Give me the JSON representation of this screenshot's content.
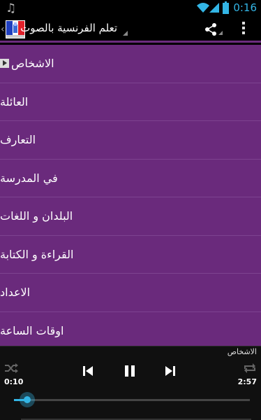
{
  "status_bar": {
    "time": "0:16",
    "icons": [
      "music-note-icon",
      "wifi-icon",
      "signal-icon",
      "battery-icon"
    ],
    "accent": "#33b5e5"
  },
  "action_bar": {
    "title": "تعلم الفرنسية بالصوت",
    "icons": [
      "app-logo-icon",
      "share-icon",
      "overflow-menu-icon"
    ],
    "divider_color": "#6b2c7e"
  },
  "list": {
    "background": "#6a2a7c",
    "items": [
      {
        "label": "الاشخاص"
      },
      {
        "label": "العائلة"
      },
      {
        "label": "التعارف"
      },
      {
        "label": "في المدرسة"
      },
      {
        "label": "البلدان و اللغات"
      },
      {
        "label": "القراءة و الكتابة"
      },
      {
        "label": "الاعداد"
      },
      {
        "label": "اوقات الساعة"
      }
    ]
  },
  "player": {
    "now_playing": "الاشخاص",
    "current_time": "0:10",
    "total_time": "2:57",
    "progress_fraction": 0.056,
    "icons": [
      "shuffle-icon",
      "previous-icon",
      "pause-icon",
      "next-icon",
      "repeat-icon"
    ]
  }
}
